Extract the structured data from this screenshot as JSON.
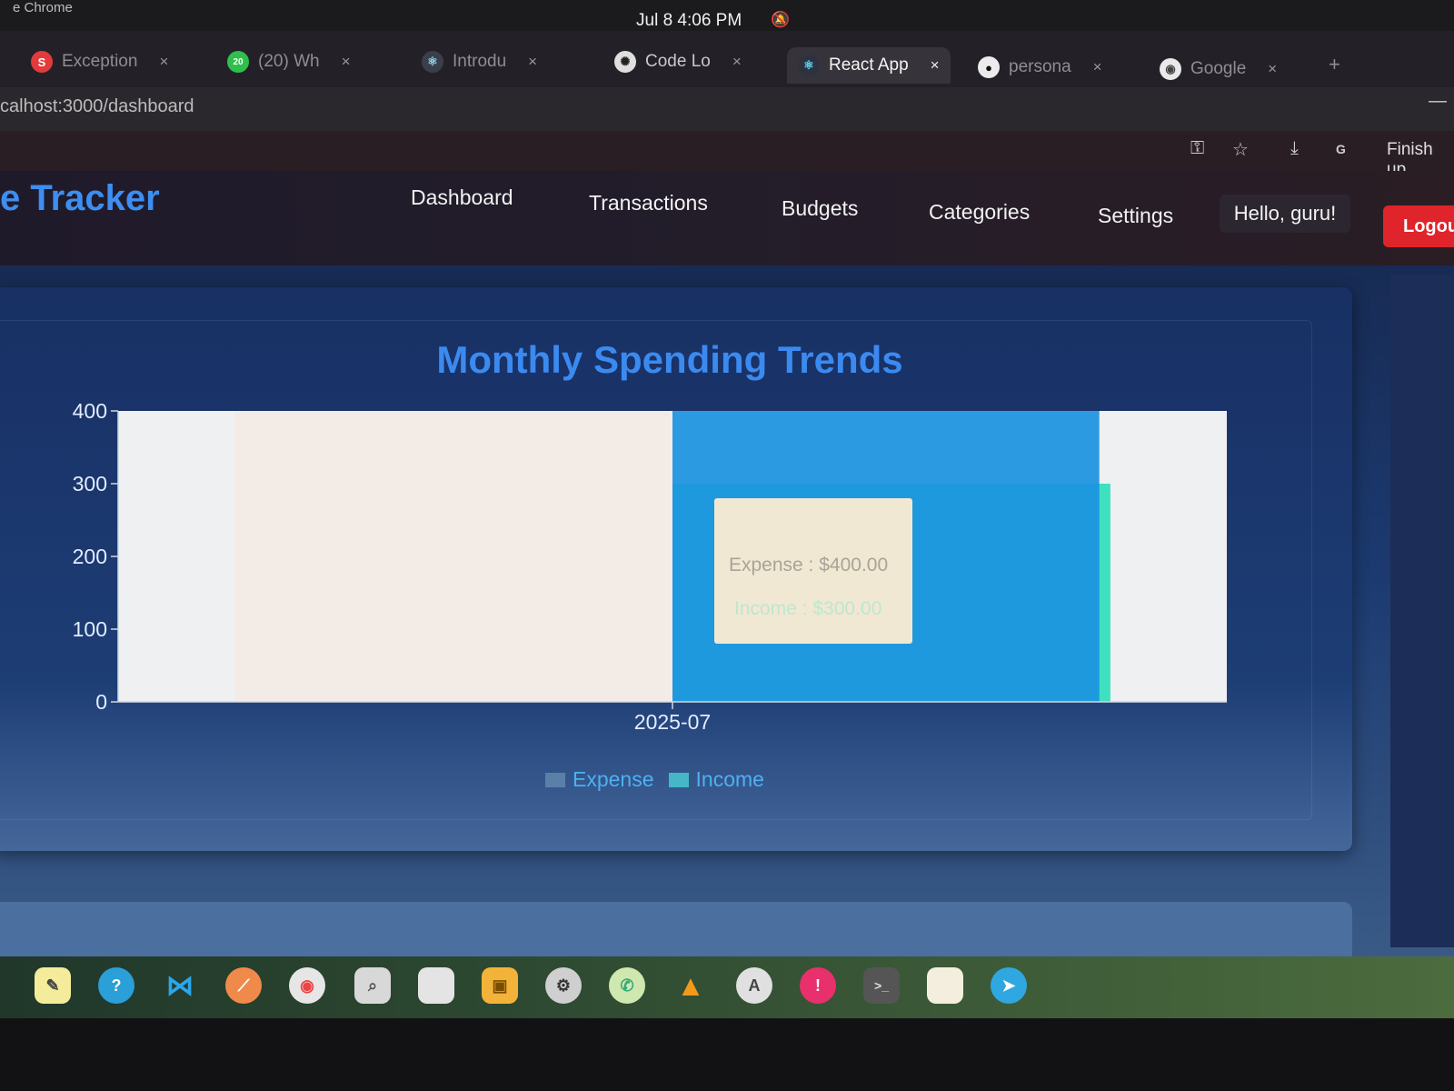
{
  "system": {
    "app_menu": "e Chrome",
    "clock": "Jul 8   4:06 PM"
  },
  "browser": {
    "tabs": [
      {
        "label": "Exception",
        "icon": "stackoverflow-icon",
        "active": false
      },
      {
        "label": "(20) Wh",
        "icon": "whatsapp-icon",
        "badge": "20",
        "active": false
      },
      {
        "label": "Introdu",
        "icon": "react-icon",
        "active": false
      },
      {
        "label": "Code Lo",
        "icon": "openai-icon",
        "active": false
      },
      {
        "label": "React App",
        "icon": "react-icon",
        "active": true
      },
      {
        "label": "persona",
        "icon": "github-icon",
        "active": false
      },
      {
        "label": "Google",
        "icon": "google-lens-icon",
        "active": false
      }
    ],
    "new_tab": "+",
    "url": "calhost:3000/dashboard",
    "toolbar_right": "Finish up",
    "profile_letter": "G"
  },
  "app": {
    "brand": "e Tracker",
    "nav": [
      "Dashboard",
      "Transactions",
      "Budgets",
      "Categories",
      "Settings"
    ],
    "greeting": "Hello, guru!",
    "logout": "Logou"
  },
  "chart_data": {
    "type": "bar",
    "title": "Monthly Spending Trends",
    "categories": [
      "2025-07"
    ],
    "series": [
      {
        "name": "Expense",
        "values": [
          400
        ],
        "color": "#f2ebe6"
      },
      {
        "name": "Income",
        "values": [
          300
        ],
        "color": "#3fe0c0"
      }
    ],
    "ylim": [
      0,
      400
    ],
    "yticks": [
      0,
      100,
      200,
      300,
      400
    ],
    "legend": "bottom",
    "hover_highlight": "#1b92e0",
    "tooltip": {
      "lines": [
        "Expense : $400.00",
        "Income : $300.00"
      ]
    }
  }
}
